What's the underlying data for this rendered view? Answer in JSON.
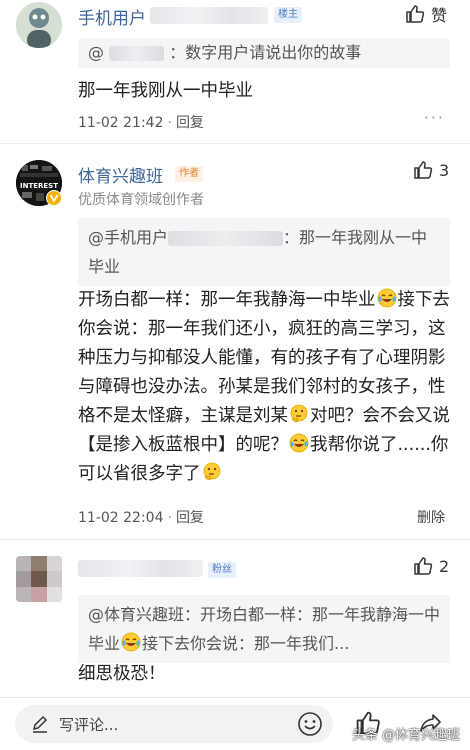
{
  "comments": [
    {
      "name": "手机用户",
      "badge": "楼主",
      "like_label": "赞",
      "quote_prefix": "@",
      "quote_suffix": "：数字用户请说出你的故事",
      "text": "那一年我刚从一中毕业",
      "time": "11-02 21:42",
      "reply_label": "回复",
      "more": "···"
    },
    {
      "name": "体育兴趣班",
      "badge": "作者",
      "subtitle": "优质体育领域创作者",
      "like_count": "3",
      "quote_prefix": "@手机用户",
      "quote_suffix": "：那一年我刚从一中毕业",
      "text_parts": [
        "开场白都一样：那一年我静海一中毕业",
        "接下去你会说：那一年我们还小，疯狂的高三学习，这种压力与抑郁没人能懂，有的孩子有了心理阴影与障碍也没办法。孙某是我们邻村的女孩子，性格不是太怪癖，主谋是刘某",
        "对吧？会不会又说【是掺入板蓝根中】的呢？",
        "我帮你说了......你可以省很多字了"
      ],
      "time": "11-02 22:04",
      "reply_label": "回复",
      "delete_label": "删除"
    },
    {
      "badge": "粉丝",
      "like_count": "2",
      "quote_part1": "@体育兴趣班：开场白都一样：那一年我静海一中毕业",
      "quote_part2": "接下去你会说：那一年我们...",
      "text": "细思极恐！"
    }
  ],
  "bottom_bar": {
    "placeholder": "写评论...",
    "watermark": "头条 @体育兴趣班"
  },
  "colors": {
    "username": "#406599",
    "badge_blue": "#4d7cc4",
    "badge_orange": "#e8822e",
    "quote_bg": "#f4f5f7"
  }
}
